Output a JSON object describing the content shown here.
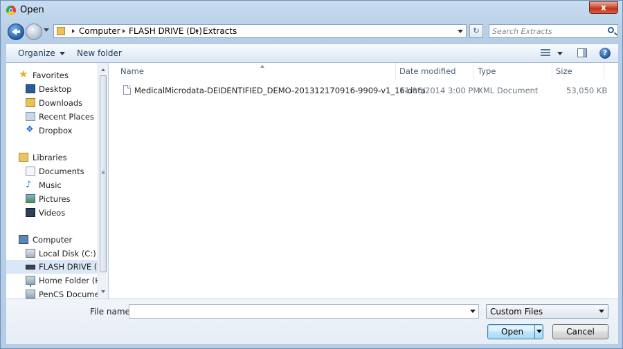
{
  "window": {
    "title": "Open",
    "close_label": "x"
  },
  "address": {
    "crumbs": [
      "Computer",
      "FLASH DRIVE (D:)",
      "Extracts"
    ]
  },
  "search": {
    "placeholder": "Search Extracts"
  },
  "toolbar": {
    "organize_label": "Organize",
    "new_folder_label": "New folder",
    "help_label": "?"
  },
  "nav": {
    "favorites": {
      "label": "Favorites",
      "items": [
        "Desktop",
        "Downloads",
        "Recent Places",
        "Dropbox"
      ]
    },
    "libraries": {
      "label": "Libraries",
      "items": [
        "Documents",
        "Music",
        "Pictures",
        "Videos"
      ]
    },
    "computer": {
      "label": "Computer",
      "items": [
        "Local Disk (C:)",
        "FLASH DRIVE (D:)",
        "Home Folder (H:)",
        "PenCS Documen"
      ]
    }
  },
  "filelist": {
    "columns": [
      "Name",
      "Date modified",
      "Type",
      "Size"
    ],
    "rows": [
      {
        "name": "MedicalMicrodata-DEIDENTIFIED_DEMO-201312170916-9909-v1_16-data",
        "date_modified": "11/06/2014 3:00 PM",
        "type": "XML Document",
        "size": "53,050 KB"
      }
    ]
  },
  "bottom": {
    "file_name_label": "File name:",
    "file_name_value": "",
    "filter_selected": "Custom Files",
    "open_label": "Open",
    "cancel_label": "Cancel"
  }
}
